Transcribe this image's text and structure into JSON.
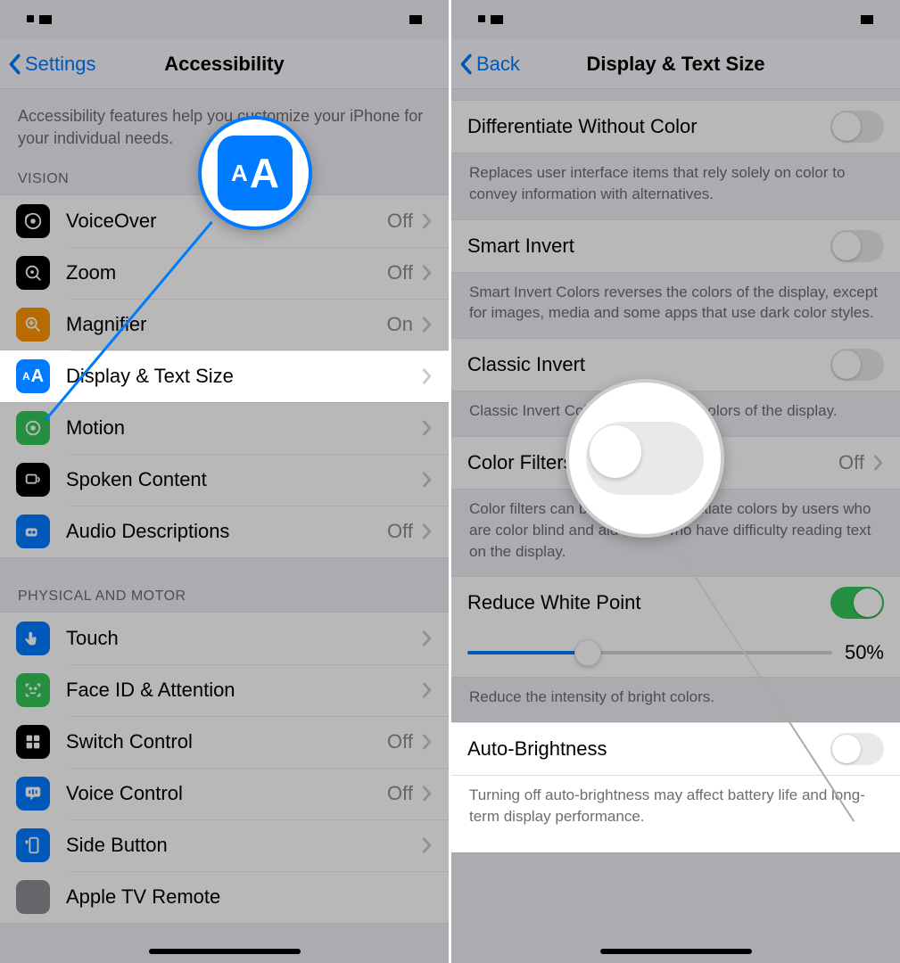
{
  "left": {
    "back": "Settings",
    "title": "Accessibility",
    "intro": "Accessibility features help you customize your iPhone for your individual needs.",
    "section_vision": "VISION",
    "rows_vision": [
      {
        "label": "VoiceOver",
        "value": "Off"
      },
      {
        "label": "Zoom",
        "value": "Off"
      },
      {
        "label": "Magnifier",
        "value": "On"
      },
      {
        "label": "Display & Text Size",
        "value": ""
      },
      {
        "label": "Motion",
        "value": ""
      },
      {
        "label": "Spoken Content",
        "value": ""
      },
      {
        "label": "Audio Descriptions",
        "value": "Off"
      }
    ],
    "section_physical": "PHYSICAL AND MOTOR",
    "rows_physical": [
      {
        "label": "Touch",
        "value": ""
      },
      {
        "label": "Face ID & Attention",
        "value": ""
      },
      {
        "label": "Switch Control",
        "value": "Off"
      },
      {
        "label": "Voice Control",
        "value": "Off"
      },
      {
        "label": "Side Button",
        "value": ""
      },
      {
        "label": "Apple TV Remote",
        "value": ""
      }
    ],
    "callout_icon_label": "AA"
  },
  "right": {
    "back": "Back",
    "title": "Display & Text Size",
    "items": [
      {
        "label": "Differentiate Without Color",
        "footer": "Replaces user interface items that rely solely on color to convey information with alternatives.",
        "type": "toggle",
        "on": false
      },
      {
        "label": "Smart Invert",
        "footer": "Smart Invert Colors reverses the colors of the display, except for images, media and some apps that use dark color styles.",
        "type": "toggle",
        "on": false
      },
      {
        "label": "Classic Invert",
        "footer": "Classic Invert Colors reverses the colors of the display.",
        "type": "toggle",
        "on": false
      },
      {
        "label": "Color Filters",
        "footer": "Color filters can be used to differentiate colors by users who are color blind and aid users who have difficulty reading text on the display.",
        "type": "nav",
        "value": "Off"
      },
      {
        "label": "Reduce White Point",
        "footer": "Reduce the intensity of bright colors.",
        "type": "toggle",
        "on": true,
        "slider": "50%",
        "slider_pct": 33
      },
      {
        "label": "Auto-Brightness",
        "footer": "Turning off auto-brightness may affect battery life and long-term display performance.",
        "type": "toggle",
        "on": false,
        "highlight": true
      }
    ]
  }
}
